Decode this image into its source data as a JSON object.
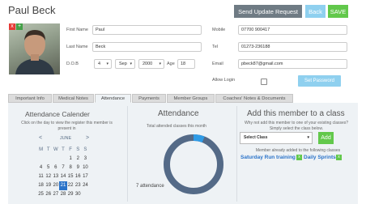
{
  "member": {
    "name": "Paul Beck"
  },
  "toolbar": {
    "update_label": "Send Update Request",
    "back_label": "Back",
    "save_label": "SAVE"
  },
  "photo": {
    "delete_icon": "x",
    "upload_icon": "+"
  },
  "form": {
    "first_name_label": "First Name",
    "first_name": "Paul",
    "last_name_label": "Last Name",
    "last_name": "Beck",
    "dob_label": "D.O.B",
    "dob_day": "4",
    "dob_month": "Sep",
    "dob_year": "2000",
    "age_label": "Age",
    "age": "18",
    "mobile_label": "Mobile",
    "mobile": "07700 900417",
    "tel_label": "Tel",
    "tel": "01273-236188",
    "email_label": "Email",
    "email": "pbeck87@gmail.com",
    "allow_login_label": "Allow Login",
    "set_password_label": "Set Password"
  },
  "tabs": [
    {
      "label": "Important Info"
    },
    {
      "label": "Medical Notes"
    },
    {
      "label": "Attendance"
    },
    {
      "label": "Payments"
    },
    {
      "label": "Member Groups"
    },
    {
      "label": "Coaches' Notes & Documents"
    }
  ],
  "calendar": {
    "title": "Attendance Calender",
    "subtitle": "Click on the day to view the register this member is present in",
    "prev": "<",
    "next": ">",
    "month": "JUNE",
    "weekdays": [
      "M",
      "T",
      "W",
      "T",
      "F",
      "S",
      "S"
    ],
    "weeks": [
      [
        "",
        "",
        "",
        "",
        "1",
        "2",
        "3"
      ],
      [
        "4",
        "5",
        "6",
        "7",
        "8",
        "9",
        "10"
      ],
      [
        "11",
        "12",
        "13",
        "14",
        "15",
        "16",
        "17"
      ],
      [
        "18",
        "19",
        "20",
        "21",
        "22",
        "23",
        "24"
      ],
      [
        "25",
        "26",
        "27",
        "28",
        "29",
        "30",
        ""
      ]
    ],
    "today": "21"
  },
  "attendance": {
    "title": "Attendance",
    "subtitle": "Total attended classes this month",
    "count_text": "7 attendance",
    "fraction": 0.06,
    "colors": {
      "track": "#546a87",
      "value": "#2e9be6"
    }
  },
  "add_class": {
    "title": "Add this member to a class",
    "subtitle": "Why not add this member to one of your existing classes? Simply select the class below.",
    "select_placeholder": "Select Class",
    "add_label": "Add",
    "enrolled_subtitle": "Member already added to the following classes",
    "enrolled": [
      {
        "name": "Saturday Run training",
        "remove_icon": "x"
      },
      {
        "name": "Daily Sprints",
        "remove_icon": "x"
      }
    ]
  },
  "colors": {
    "accent": "#2a73c9",
    "green": "#62c84b",
    "light_blue": "#8fd0ef",
    "grey_button": "#6f7b84"
  }
}
